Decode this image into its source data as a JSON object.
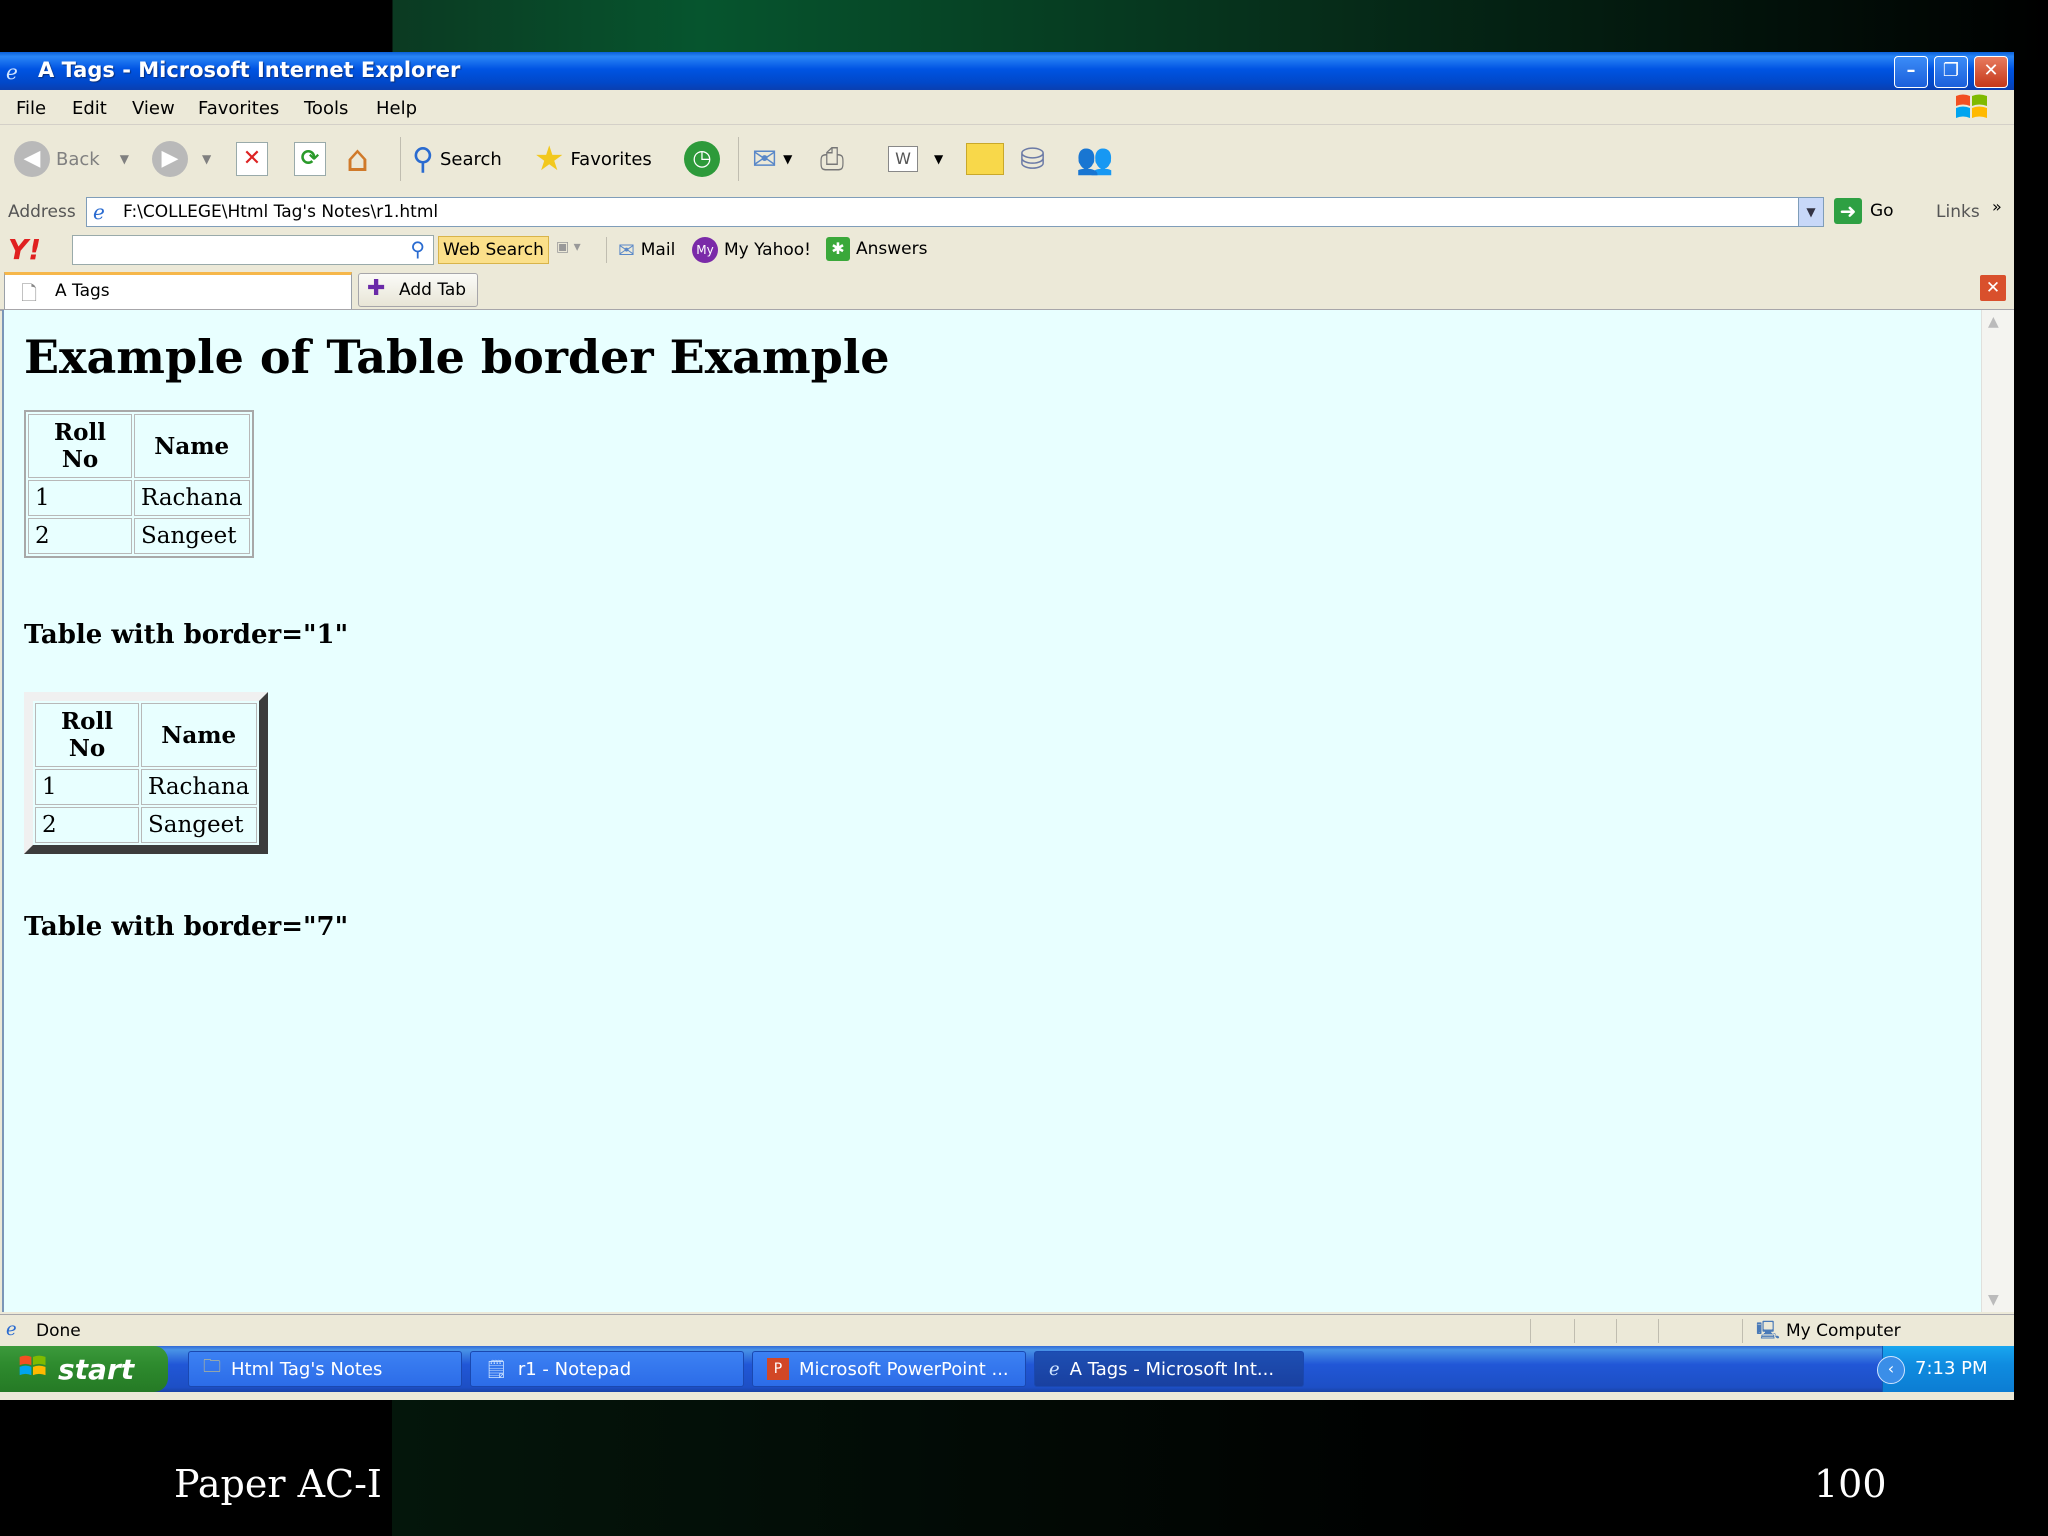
{
  "window": {
    "title": "A Tags - Microsoft Internet Explorer"
  },
  "menu": [
    "File",
    "Edit",
    "View",
    "Favorites",
    "Tools",
    "Help"
  ],
  "toolbar": {
    "back": "Back",
    "search": "Search",
    "favorites": "Favorites"
  },
  "address": {
    "label": "Address",
    "value": "F:\\COLLEGE\\Html Tag's Notes\\r1.html",
    "go": "Go",
    "links": "Links"
  },
  "yahoo": {
    "logo": "Y!",
    "web_search": "Web Search",
    "mail": "Mail",
    "my_yahoo": "My Yahoo!",
    "answers": "Answers"
  },
  "tabs": {
    "active": "A Tags",
    "add": "Add Tab"
  },
  "page": {
    "heading": "Example of Table border Example",
    "table_headers": [
      "Roll No",
      "Name"
    ],
    "rows": [
      [
        "1",
        "Rachana"
      ],
      [
        "2",
        "Sangeet"
      ]
    ],
    "caption1": "Table with border=\"1\"",
    "caption2": "Table with border=\"7\""
  },
  "status": {
    "text": "Done",
    "zone": "My Computer"
  },
  "taskbar": {
    "start": "start",
    "tasks": [
      "Html Tag's Notes",
      "r1 - Notepad",
      "Microsoft PowerPoint ...",
      "A Tags - Microsoft Int..."
    ],
    "clock": "7:13 PM"
  },
  "slide": {
    "footer_left": "Paper AC-I",
    "page_number": "100"
  }
}
